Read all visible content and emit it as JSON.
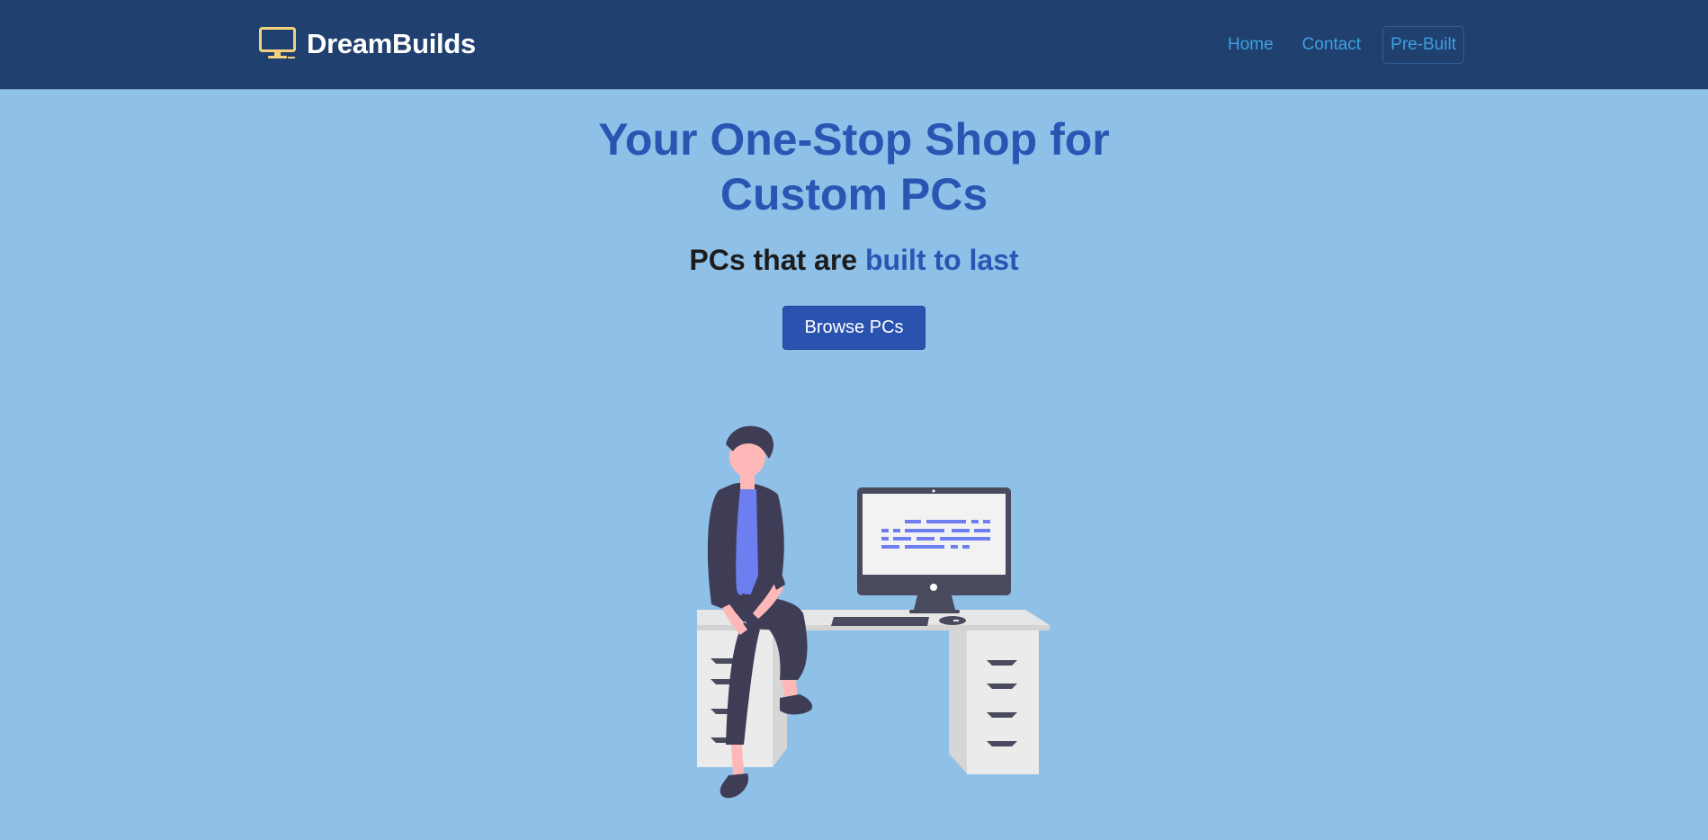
{
  "brand": {
    "name": "DreamBuilds",
    "icon": "monitor-icon"
  },
  "nav": {
    "items": [
      {
        "label": "Home"
      },
      {
        "label": "Contact"
      },
      {
        "label": "Pre-Built"
      }
    ]
  },
  "hero": {
    "title": "Your One-Stop Shop for Custom PCs",
    "subtitle_prefix": "PCs that are ",
    "subtitle_accent": "built to last",
    "button_label": "Browse PCs"
  },
  "illustration": {
    "icon": "person-at-desk-illustration"
  },
  "colors": {
    "navbar": "#20406f",
    "background": "#8fc0e8",
    "accent": "#2a56b3",
    "nav_link": "#3da0e0",
    "button": "#2a53b0"
  }
}
